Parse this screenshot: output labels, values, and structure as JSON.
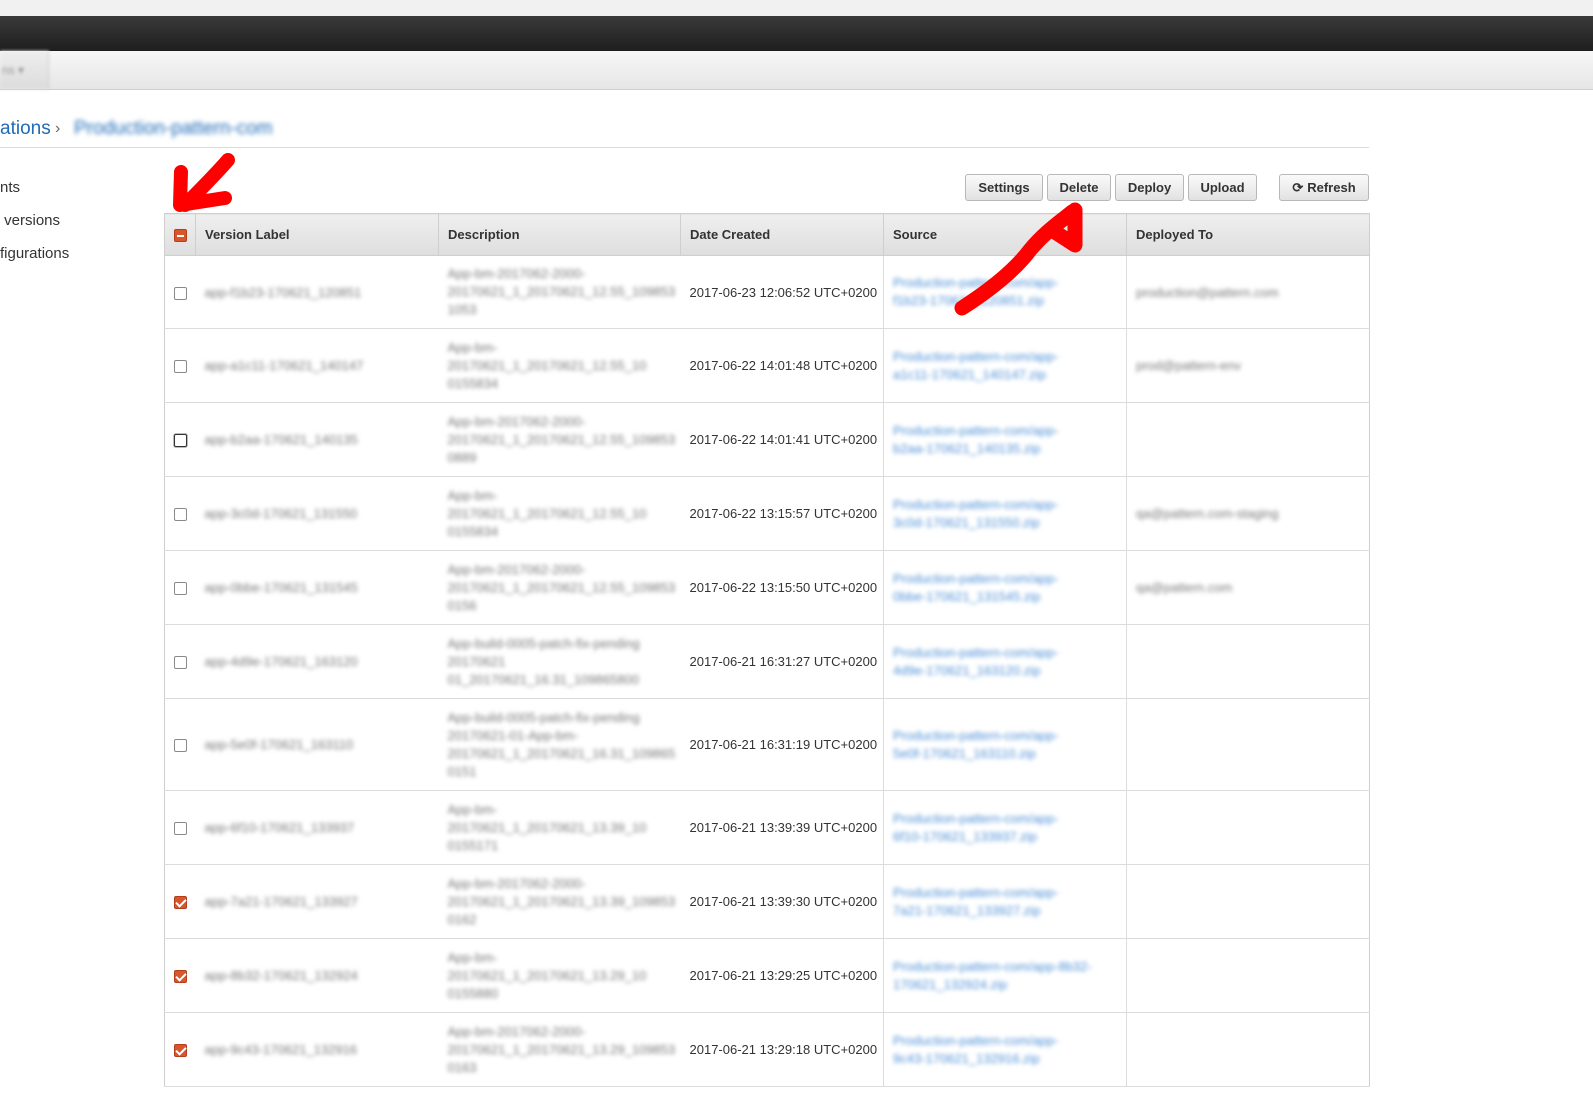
{
  "app": {
    "tab_label": "ns ▾"
  },
  "breadcrumb": {
    "parent": "ations",
    "separator": "›",
    "current": "Production-pattern-com"
  },
  "sidebar": {
    "items": [
      {
        "label": "nts"
      },
      {
        "label": " versions"
      },
      {
        "label": "figurations"
      }
    ]
  },
  "toolbar": {
    "settings": "Settings",
    "delete": "Delete",
    "deploy": "Deploy",
    "upload": "Upload",
    "refresh": "Refresh"
  },
  "table": {
    "columns": [
      "Version Label",
      "Description",
      "Date Created",
      "Source",
      "Deployed To"
    ],
    "rows": [
      {
        "checked": false,
        "label": "app-f1b23-170621_120851",
        "desc": [
          "App-bm-2017062-2000-",
          "20170621_1_20170621_12.55_109853",
          "1053"
        ],
        "date": "2017-06-23 12:06:52 UTC+0200",
        "source": [
          "Production-pattern-com/app-",
          "f1b23-170621_120851.zip"
        ],
        "deployed": "production@pattern.com"
      },
      {
        "checked": false,
        "label": "app-a1c11-170621_140147",
        "desc": [
          "App-bm-",
          "20170621_1_20170621_12.55_10",
          "0155834"
        ],
        "date": "2017-06-22 14:01:48 UTC+0200",
        "source": [
          "Production-pattern-com/app-",
          "a1c11-170621_140147.zip"
        ],
        "deployed": "prod@pattern-env"
      },
      {
        "checked": false,
        "label": "app-b2aa-170621_140135",
        "desc": [
          "App-bm-2017062-2000-",
          "20170621_1_20170621_12.55_109853",
          "0889"
        ],
        "date": "2017-06-22 14:01:41 UTC+0200",
        "source": [
          "Production-pattern-com/app-",
          "b2aa-170621_140135.zip"
        ],
        "deployed": ""
      },
      {
        "checked": false,
        "label": "app-3c0d-170621_131550",
        "desc": [
          "App-bm-",
          "20170621_1_20170621_12.55_10",
          "0155834"
        ],
        "date": "2017-06-22 13:15:57 UTC+0200",
        "source": [
          "Production-pattern-com/app-",
          "3c0d-170621_131550.zip"
        ],
        "deployed": "qa@pattern.com-staging"
      },
      {
        "checked": false,
        "label": "app-0bbe-170621_131545",
        "desc": [
          "App-bm-2017062-2000-",
          "20170621_1_20170621_12.55_109853",
          "0156"
        ],
        "date": "2017-06-22 13:15:50 UTC+0200",
        "source": [
          "Production-pattern-com/app-",
          "0bbe-170621_131545.zip"
        ],
        "deployed": "qa@pattern.com"
      },
      {
        "checked": false,
        "label": "app-4d9e-170621_163120",
        "desc": [
          "App-build-0005-patch-fix-pending",
          "20170621",
          "01_20170621_16.31_109865800"
        ],
        "date": "2017-06-21 16:31:27 UTC+0200",
        "source": [
          "Production-pattern-com/app-",
          "4d9e-170621_163120.zip"
        ],
        "deployed": ""
      },
      {
        "checked": false,
        "label": "app-5e0f-170621_163110",
        "desc": [
          "App-build-0005-patch-fix-pending",
          "20170621-01-App-bm-",
          "20170621_1_20170621_16.31_109865",
          "0151"
        ],
        "date": "2017-06-21 16:31:19 UTC+0200",
        "source": [
          "Production-pattern-com/app-",
          "5e0f-170621_163110.zip"
        ],
        "deployed": ""
      },
      {
        "checked": false,
        "label": "app-6f10-170621_133937",
        "desc": [
          "App-bm-",
          "20170621_1_20170621_13.39_10",
          "0155171"
        ],
        "date": "2017-06-21 13:39:39 UTC+0200",
        "source": [
          "Production-pattern-com/app-",
          "6f10-170621_133937.zip"
        ],
        "deployed": ""
      },
      {
        "checked": true,
        "label": "app-7a21-170621_133927",
        "desc": [
          "App-bm-2017062-2000-",
          "20170621_1_20170621_13.39_109853",
          "0162"
        ],
        "date": "2017-06-21 13:39:30 UTC+0200",
        "source": [
          "Production-pattern-com/app-",
          "7a21-170621_133927.zip"
        ],
        "deployed": ""
      },
      {
        "checked": true,
        "label": "app-8b32-170621_132924",
        "desc": [
          "App-bm-",
          "20170621_1_20170621_13.29_10",
          "0155880"
        ],
        "date": "2017-06-21 13:29:25 UTC+0200",
        "source": [
          "Production-pattern-com/app-8b32-",
          "170621_132924.zip"
        ],
        "deployed": ""
      },
      {
        "checked": true,
        "label": "app-9c43-170621_132916",
        "desc": [
          "App-bm-2017062-2000-",
          "20170621_1_20170621_13.29_109853",
          "0163"
        ],
        "date": "2017-06-21 13:29:18 UTC+0200",
        "source": [
          "Production-pattern-com/app-",
          "9c43-170621_132916.zip"
        ],
        "deployed": ""
      }
    ]
  },
  "colors": {
    "accent": "#d9552c",
    "link": "#1e6bb8",
    "annotation": "#ff0000"
  }
}
